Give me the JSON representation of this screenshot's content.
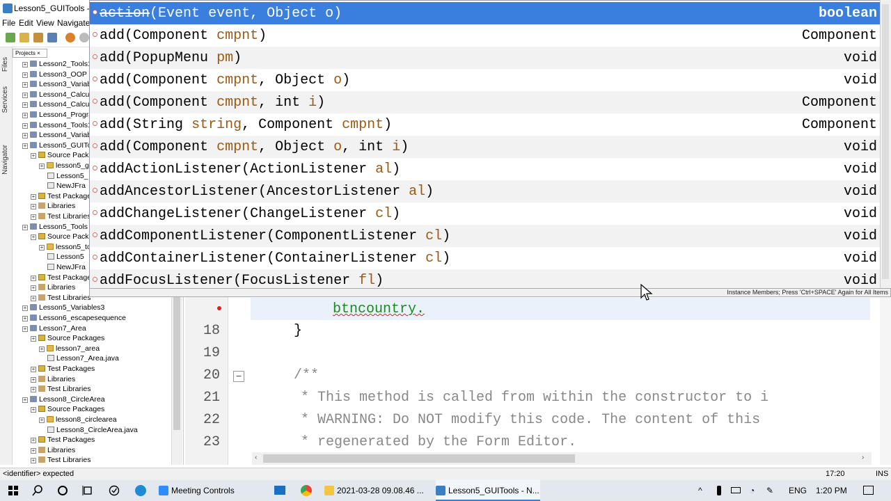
{
  "window": {
    "title": "Lesson5_GUITools - N"
  },
  "menu": [
    "File",
    "Edit",
    "View",
    "Navigate"
  ],
  "side_tabs": [
    "Files",
    "Services",
    "Navigator"
  ],
  "projects_tab": "Projects",
  "tree": [
    {
      "label": "Lesson2_Tools1",
      "level": 0,
      "icon": "proj"
    },
    {
      "label": "Lesson3_OOP",
      "level": 0,
      "icon": "proj"
    },
    {
      "label": "Lesson3_Variable",
      "level": 0,
      "icon": "proj"
    },
    {
      "label": "Lesson4_Calculat",
      "level": 0,
      "icon": "proj"
    },
    {
      "label": "Lesson4_Calculat",
      "level": 0,
      "icon": "proj"
    },
    {
      "label": "Lesson4_Prograr",
      "level": 0,
      "icon": "proj"
    },
    {
      "label": "Lesson4_Tools1",
      "level": 0,
      "icon": "proj"
    },
    {
      "label": "Lesson4_Variable",
      "level": 0,
      "icon": "proj"
    },
    {
      "label": "Lesson5_GUITo",
      "level": 0,
      "icon": "proj"
    },
    {
      "label": "Source Packag",
      "level": 1,
      "icon": "src"
    },
    {
      "label": "lesson5_gu",
      "level": 2,
      "icon": "pkg"
    },
    {
      "label": "Lesson5_",
      "level": 3,
      "icon": "file"
    },
    {
      "label": "NewJFra",
      "level": 3,
      "icon": "file"
    },
    {
      "label": "Test Packages",
      "level": 1,
      "icon": "src"
    },
    {
      "label": "Libraries",
      "level": 1,
      "icon": "lib"
    },
    {
      "label": "Test Libraries",
      "level": 1,
      "icon": "lib"
    },
    {
      "label": "Lesson5_Tools",
      "level": 0,
      "icon": "proj"
    },
    {
      "label": "Source Packag",
      "level": 1,
      "icon": "src"
    },
    {
      "label": "lesson5_toc",
      "level": 2,
      "icon": "pkg"
    },
    {
      "label": "Lesson5",
      "level": 3,
      "icon": "file"
    },
    {
      "label": "NewJFra",
      "level": 3,
      "icon": "file"
    },
    {
      "label": "Test Packages",
      "level": 1,
      "icon": "src"
    },
    {
      "label": "Libraries",
      "level": 1,
      "icon": "lib"
    },
    {
      "label": "Test Libraries",
      "level": 1,
      "icon": "lib"
    },
    {
      "label": "Lesson5_Variables3",
      "level": 0,
      "icon": "proj"
    },
    {
      "label": "Lesson6_escapesequence",
      "level": 0,
      "icon": "proj"
    },
    {
      "label": "Lesson7_Area",
      "level": 0,
      "icon": "proj"
    },
    {
      "label": "Source Packages",
      "level": 1,
      "icon": "src"
    },
    {
      "label": "lesson7_area",
      "level": 2,
      "icon": "pkg"
    },
    {
      "label": "Lesson7_Area.java",
      "level": 3,
      "icon": "file"
    },
    {
      "label": "Test Packages",
      "level": 1,
      "icon": "src"
    },
    {
      "label": "Libraries",
      "level": 1,
      "icon": "lib"
    },
    {
      "label": "Test Libraries",
      "level": 1,
      "icon": "lib"
    },
    {
      "label": "Lesson8_CircleArea",
      "level": 0,
      "icon": "proj"
    },
    {
      "label": "Source Packages",
      "level": 1,
      "icon": "src"
    },
    {
      "label": "lesson8_circlearea",
      "level": 2,
      "icon": "pkg"
    },
    {
      "label": "Lesson8_CircleArea.java",
      "level": 3,
      "icon": "file"
    },
    {
      "label": "Test Packages",
      "level": 1,
      "icon": "src"
    },
    {
      "label": "Libraries",
      "level": 1,
      "icon": "lib"
    },
    {
      "label": "Test Libraries",
      "level": 1,
      "icon": "lib"
    }
  ],
  "completion": {
    "items": [
      {
        "name": "action",
        "args": [
          [
            "Event",
            "event"
          ],
          [
            "Object",
            "o"
          ]
        ],
        "ret": "boolean",
        "selected": true
      },
      {
        "name": "add",
        "args": [
          [
            "Component",
            "cmpnt"
          ]
        ],
        "ret": "Component"
      },
      {
        "name": "add",
        "args": [
          [
            "PopupMenu",
            "pm"
          ]
        ],
        "ret": "void"
      },
      {
        "name": "add",
        "args": [
          [
            "Component",
            "cmpnt"
          ],
          [
            "Object",
            "o"
          ]
        ],
        "ret": "void"
      },
      {
        "name": "add",
        "args": [
          [
            "Component",
            "cmpnt"
          ],
          [
            "int",
            "i"
          ]
        ],
        "ret": "Component"
      },
      {
        "name": "add",
        "args": [
          [
            "String",
            "string"
          ],
          [
            "Component",
            "cmpnt"
          ]
        ],
        "ret": "Component"
      },
      {
        "name": "add",
        "args": [
          [
            "Component",
            "cmpnt"
          ],
          [
            "Object",
            "o"
          ],
          [
            "int",
            "i"
          ]
        ],
        "ret": "void"
      },
      {
        "name": "addActionListener",
        "args": [
          [
            "ActionListener",
            "al"
          ]
        ],
        "ret": "void"
      },
      {
        "name": "addAncestorListener",
        "args": [
          [
            "AncestorListener",
            "al"
          ]
        ],
        "ret": "void"
      },
      {
        "name": "addChangeListener",
        "args": [
          [
            "ChangeListener",
            "cl"
          ]
        ],
        "ret": "void"
      },
      {
        "name": "addComponentListener",
        "args": [
          [
            "ComponentListener",
            "cl"
          ]
        ],
        "ret": "void"
      },
      {
        "name": "addContainerListener",
        "args": [
          [
            "ContainerListener",
            "cl"
          ]
        ],
        "ret": "void"
      },
      {
        "name": "addFocusListener",
        "args": [
          [
            "FocusListener",
            "fl"
          ]
        ],
        "ret": "void"
      }
    ],
    "status": "Instance Members; Press 'Ctrl+SPACE' Again for All Items"
  },
  "editor": {
    "current_code": "btncountry.",
    "lines": [
      {
        "num": "18",
        "text": "}",
        "indent": "    "
      },
      {
        "num": "19",
        "text": "",
        "indent": ""
      },
      {
        "num": "20",
        "text": "/**",
        "indent": "    "
      },
      {
        "num": "21",
        "text": " * This method is called from within the constructor to i",
        "indent": "    "
      },
      {
        "num": "22",
        "text": " * WARNING: Do NOT modify this code. The content of this",
        "indent": "    "
      },
      {
        "num": "23",
        "text": " * regenerated by the Form Editor.",
        "indent": "    "
      }
    ]
  },
  "statusbar": {
    "left": "<identifier> expected",
    "position": "17:20",
    "mode": "INS"
  },
  "taskbar": {
    "items": [
      {
        "label": "Meeting Controls",
        "color": "#2d8cff"
      },
      {
        "label": "2021-03-28 09.08.46 ...",
        "color": "#f4c542"
      },
      {
        "label": "Lesson5_GUITools - N...",
        "color": "#3a7fc4"
      }
    ],
    "lang": "ENG",
    "time": "1:20 PM"
  },
  "colors": {
    "selection": "#3a7fde",
    "param": "#a0580a",
    "code_ident": "#1a8a1a",
    "comment": "#888888"
  }
}
